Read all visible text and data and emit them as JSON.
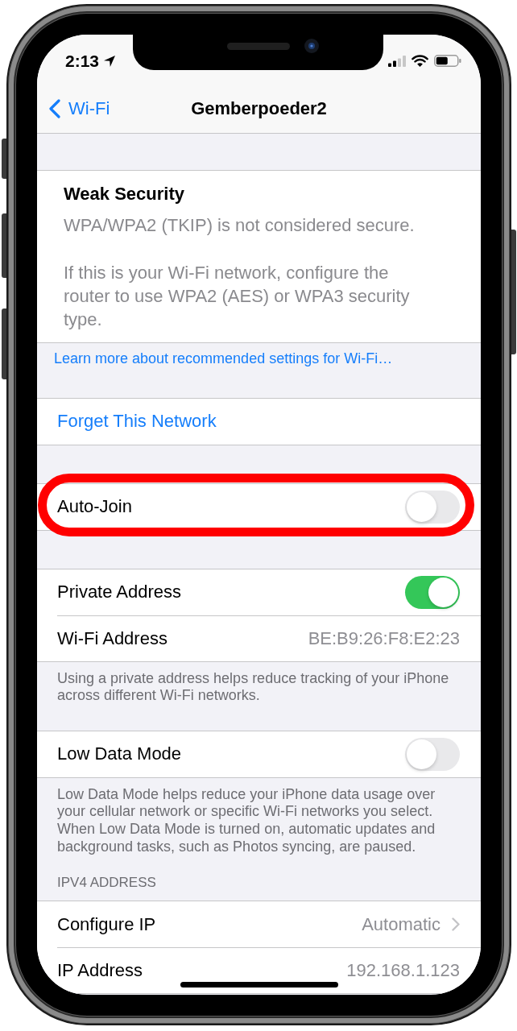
{
  "status_bar": {
    "time": "2:13"
  },
  "nav_bar": {
    "back": "Wi-Fi",
    "title": "Gemberpoeder2"
  },
  "warning": {
    "title": "Weak Security",
    "paragraphs": [
      "WPA/WPA2 (TKIP) is not considered secure.",
      "If this is your Wi-Fi network, configure the router to use WPA2 (AES) or WPA3 security type."
    ],
    "link": "Learn more about recommended settings for Wi-Fi…"
  },
  "groups": [
    {
      "rows": [
        {
          "kind": "action",
          "label": "Forget This Network"
        }
      ]
    },
    {
      "rows": [
        {
          "kind": "switch",
          "label": "Auto-Join",
          "on": false,
          "highlighted": true
        }
      ]
    },
    {
      "rows": [
        {
          "kind": "switch",
          "label": "Private Address",
          "on": true
        },
        {
          "kind": "value",
          "label": "Wi-Fi Address",
          "value": "BE:B9:26:F8:E2:23"
        }
      ],
      "footer": "Using a private address helps reduce tracking of your iPhone across different Wi-Fi networks."
    },
    {
      "rows": [
        {
          "kind": "switch",
          "label": "Low Data Mode",
          "on": false
        }
      ],
      "footer": "Low Data Mode helps reduce your iPhone data usage over your cellular network or specific Wi-Fi networks you select. When Low Data Mode is turned on, automatic updates and background tasks, such as Photos syncing, are paused."
    },
    {
      "header": "IPV4 ADDRESS",
      "rows": [
        {
          "kind": "disclosure",
          "label": "Configure IP",
          "value": "Automatic"
        },
        {
          "kind": "value",
          "label": "IP Address",
          "value": "192.168.1.123"
        }
      ]
    }
  ]
}
